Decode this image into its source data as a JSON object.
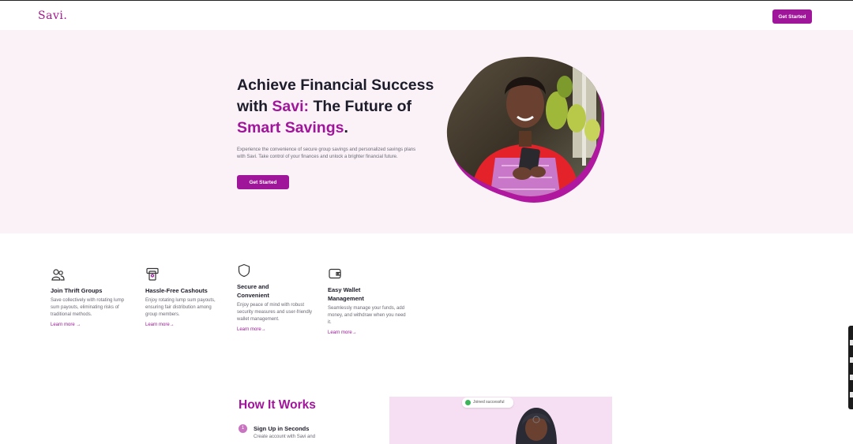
{
  "header": {
    "logo": "Savi.",
    "cta_label": "Get Started"
  },
  "hero": {
    "title_part1": "Achieve Financial Success with ",
    "title_brand": "Savi:",
    "title_part2": " The Future of ",
    "title_accent": "Smart Savings",
    "title_end": ".",
    "subtitle": "Experience the convenience of secure group savings and personalized savings plans with Savi. Take control of your finances and unlock a brighter financial future.",
    "cta_label": "Get Started"
  },
  "features": [
    {
      "icon": "users-icon",
      "title": "Join Thrift Groups",
      "description": "Save collectively with rotating lump sum payouts, eliminating risks of traditional methods.",
      "link": "Learn more →"
    },
    {
      "icon": "atm-icon",
      "title": "Hassle-Free Cashouts",
      "description": "Enjoy rotating lump sum payouts, ensuring fair distribution among group members.",
      "link": "Learn more→"
    },
    {
      "icon": "shield-icon",
      "title": "Secure and Convenient",
      "description": "Enjoy peace of mind with robust security measures and user-friendly wallet management.",
      "link": "Learn more→"
    },
    {
      "icon": "wallet-icon",
      "title": "Easy Wallet Management",
      "description": "Seamlessly manage your funds, add money, and withdraw when you need it.",
      "link": "Learn more→"
    }
  ],
  "how_it_works": {
    "title": "How It Works",
    "steps": [
      {
        "number": "1",
        "title": "Sign Up in Seconds",
        "description": "Create account with Savi and"
      }
    ],
    "toast": "Joined successful"
  },
  "colors": {
    "accent": "#a0169a",
    "hero_bg": "#fbf2f8",
    "success": "#3cb45a"
  }
}
